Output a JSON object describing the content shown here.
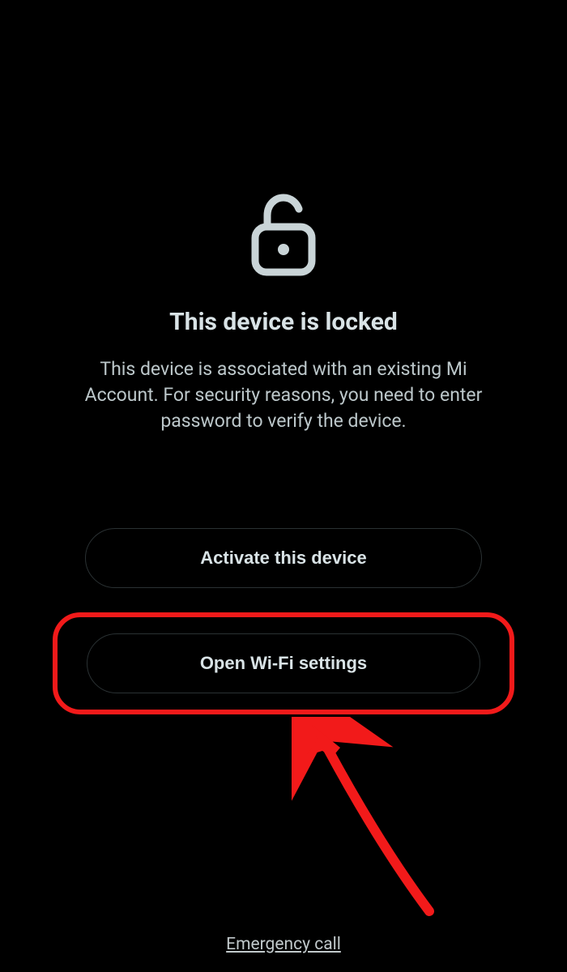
{
  "lockScreen": {
    "title": "This device is locked",
    "description": "This device is associated with an existing Mi Account. For security reasons, you need to enter password to verify the device.",
    "activateButton": "Activate this device",
    "wifiButton": "Open Wi-Fi settings",
    "emergency": "Emergency call"
  },
  "colors": {
    "background": "#000000",
    "text": "#c9d1d3",
    "highlight": "#f21a1a"
  }
}
